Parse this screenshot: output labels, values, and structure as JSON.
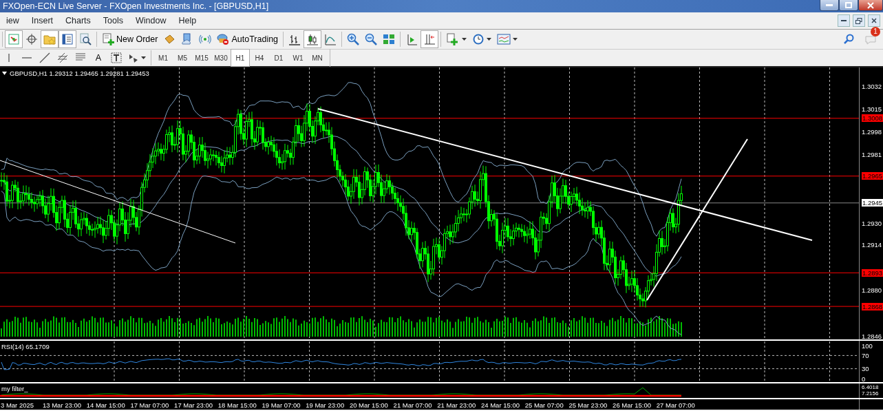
{
  "window": {
    "title": "FXOpen-ECN Live Server - FXOpen Investments Inc. - [GBPUSD,H1]"
  },
  "menu": [
    "iew",
    "Insert",
    "Charts",
    "Tools",
    "Window",
    "Help"
  ],
  "toolbar": {
    "new_order": "New Order",
    "auto_trading": "AutoTrading",
    "notification_count": "1"
  },
  "drawing_tools": {
    "text_tool": "A"
  },
  "timeframes": [
    {
      "label": "M1",
      "selected": false
    },
    {
      "label": "M5",
      "selected": false
    },
    {
      "label": "M15",
      "selected": false
    },
    {
      "label": "M30",
      "selected": false
    },
    {
      "label": "H1",
      "selected": true
    },
    {
      "label": "H4",
      "selected": false
    },
    {
      "label": "D1",
      "selected": false
    },
    {
      "label": "W1",
      "selected": false
    },
    {
      "label": "MN",
      "selected": false
    }
  ],
  "chart": {
    "header": "GBPUSD,H1  1.29312 1.29465 1.29281 1.29453",
    "price_axis": [
      {
        "text": "1.3032",
        "kind": "tick"
      },
      {
        "text": "1.3015",
        "kind": "tick"
      },
      {
        "text": "1.3008",
        "kind": "level"
      },
      {
        "text": "1.2998",
        "kind": "tick"
      },
      {
        "text": "1.2981",
        "kind": "tick"
      },
      {
        "text": "1.2965",
        "kind": "level"
      },
      {
        "text": "1.2945",
        "kind": "current"
      },
      {
        "text": "1.2930",
        "kind": "tick"
      },
      {
        "text": "1.2914",
        "kind": "tick"
      },
      {
        "text": "1.2893",
        "kind": "level"
      },
      {
        "text": "1.2880",
        "kind": "tick"
      },
      {
        "text": "1.2868",
        "kind": "level"
      },
      {
        "text": "1.2846",
        "kind": "tick"
      }
    ],
    "rsi": {
      "label": "RSI(14) 65.1709",
      "axis": [
        "100",
        "70",
        "30",
        "0"
      ]
    },
    "filter": {
      "label": "my filter_",
      "axis": [
        "6.4018",
        "7.2156"
      ]
    },
    "time_axis": [
      "3 Mar 2025",
      "13 Mar 23:00",
      "14 Mar 15:00",
      "17 Mar 07:00",
      "17 Mar 23:00",
      "18 Mar 15:00",
      "19 Mar 07:00",
      "19 Mar 23:00",
      "20 Mar 15:00",
      "21 Mar 07:00",
      "21 Mar 23:00",
      "24 Mar 15:00",
      "25 Mar 07:00",
      "25 Mar 23:00",
      "26 Mar 15:00",
      "27 Mar 07:00"
    ]
  }
}
